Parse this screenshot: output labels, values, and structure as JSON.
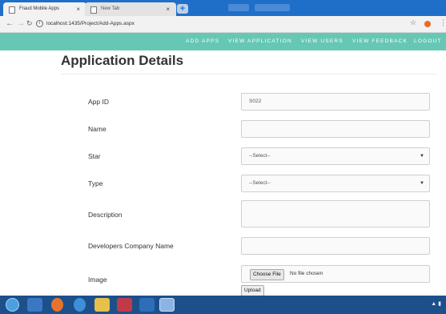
{
  "browser": {
    "tabs": [
      {
        "title": "Fraud Mobile Apps",
        "active": true
      },
      {
        "title": "New Tab",
        "active": false
      }
    ],
    "new_tab_symbol": "+",
    "close_symbol": "×",
    "url": "localhost:1435/Project/Add-Apps.aspx",
    "icons": [
      "back-icon",
      "forward-icon",
      "reload-icon",
      "info-icon",
      "star-icon",
      "extension-icon",
      "menu-icon"
    ]
  },
  "nav": {
    "add_apps": "ADD APPS",
    "view_application": "VIEW APPLICATION",
    "view_users": "VIEW USERS",
    "view_feedback": "VIEW FEEDBACK",
    "logout": "LOGOUT"
  },
  "page": {
    "title": "Application Details"
  },
  "form": {
    "app_id": {
      "label": "App ID",
      "value": "S022"
    },
    "name": {
      "label": "Name",
      "value": ""
    },
    "star": {
      "label": "Star",
      "selected": "--Select--"
    },
    "type": {
      "label": "Type",
      "selected": "--Select--"
    },
    "description": {
      "label": "Description",
      "value": ""
    },
    "company": {
      "label": "Developers Company Name",
      "value": ""
    },
    "image": {
      "label": "Image",
      "choose_label": "Choose File",
      "file_status": "No file chosen"
    },
    "upload_label": "Upload"
  },
  "colors": {
    "navbar": "#66c8b4",
    "tabbar": "#1f6fc9",
    "taskbar": "#1d4f8a"
  }
}
